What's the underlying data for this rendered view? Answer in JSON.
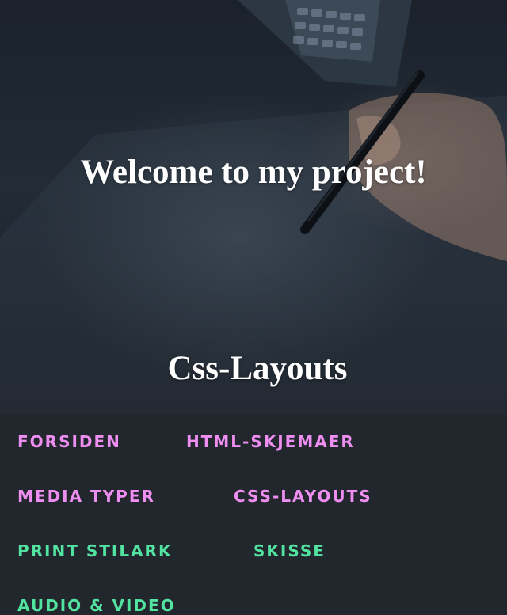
{
  "hero": {
    "title": "Welcome to my project!",
    "subtitle": "Css-Layouts"
  },
  "nav": {
    "items": [
      {
        "label": "Forsiden",
        "color": "#ee8ef0"
      },
      {
        "label": "HTML-skjemaer",
        "color": "#ee8ef0"
      },
      {
        "label": "Media typer",
        "color": "#ee8ef0"
      },
      {
        "label": "Css-layouts",
        "color": "#ee8ef0"
      },
      {
        "label": "Print stilark",
        "color": "#52e3a0"
      },
      {
        "label": "Skisse",
        "color": "#52e3a0"
      },
      {
        "label": "Audio & video",
        "color": "#52e3a0"
      }
    ]
  }
}
